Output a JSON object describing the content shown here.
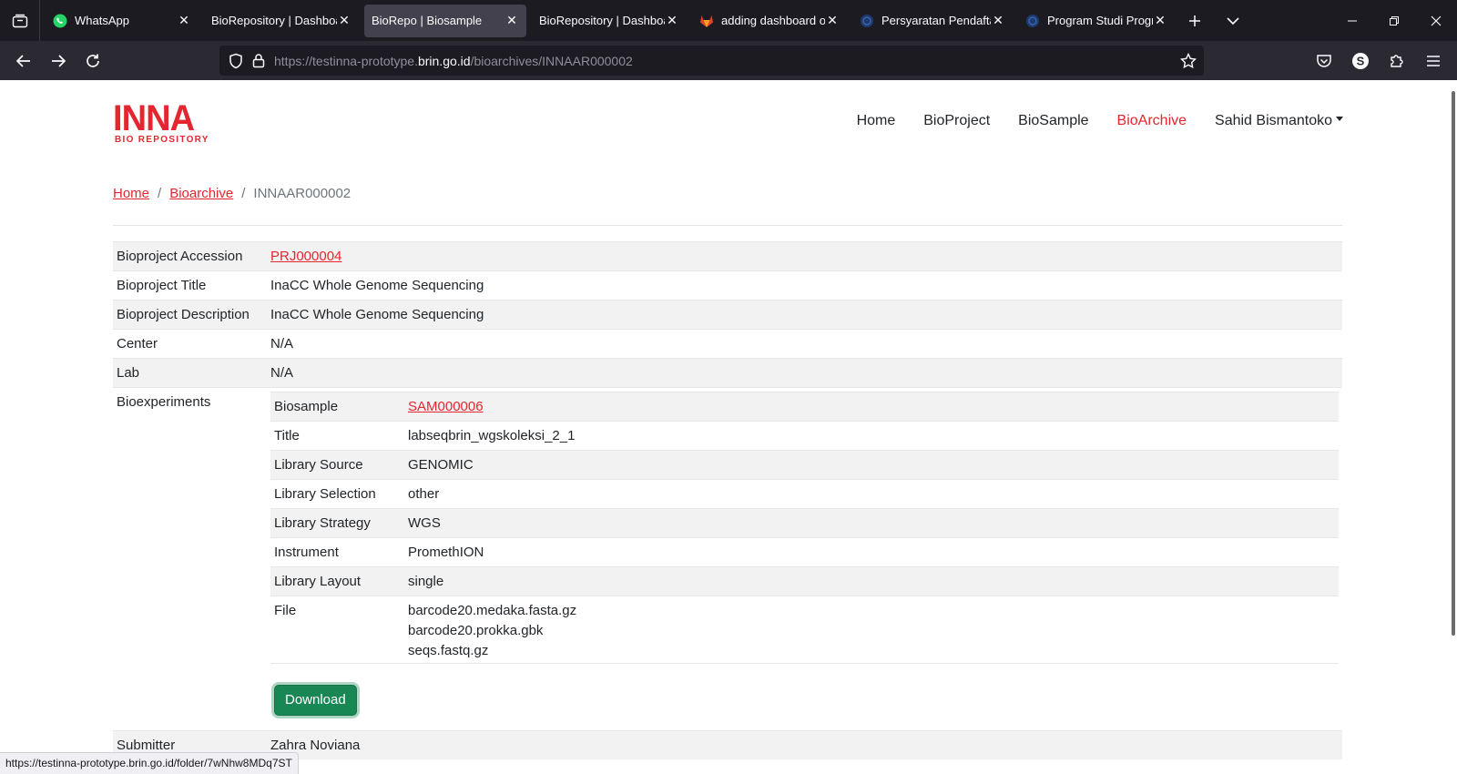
{
  "browser": {
    "tabs": [
      {
        "title": "WhatsApp",
        "active": false,
        "icon": "whatsapp-icon"
      },
      {
        "title": "BioRepository | Dashboard",
        "active": false,
        "icon": ""
      },
      {
        "title": "BioRepo | Biosample",
        "active": true,
        "icon": ""
      },
      {
        "title": "BioRepository | Dashboard",
        "active": false,
        "icon": ""
      },
      {
        "title": "adding dashboard on l",
        "active": false,
        "icon": "gitlab-icon"
      },
      {
        "title": "Persyaratan Pendaftara",
        "active": false,
        "icon": "globe-icon"
      },
      {
        "title": "Program Studi Progran",
        "active": false,
        "icon": "globe-icon"
      }
    ],
    "url_prefix": "https://testinna-prototype.",
    "url_domain": "brin.go.id",
    "url_path": "/bioarchives/INNAAR000002",
    "status_url": "https://testinna-prototype.brin.go.id/folder/7wNhw8MDq7ST"
  },
  "site": {
    "logo_main": "INNA",
    "logo_sub": "BIO REPOSITORY",
    "nav": [
      {
        "label": "Home",
        "active": false
      },
      {
        "label": "BioProject",
        "active": false
      },
      {
        "label": "BioSample",
        "active": false
      },
      {
        "label": "BioArchive",
        "active": true
      }
    ],
    "user_menu": "Sahid Bismantoko",
    "accent": "#e3262f"
  },
  "breadcrumb": {
    "home": "Home",
    "section": "Bioarchive",
    "current": "INNAAR000002"
  },
  "details": {
    "accession_label": "Bioproject Accession",
    "accession_value": "PRJ000004",
    "title_label": "Bioproject Title",
    "title_value": "InaCC Whole Genome Sequencing",
    "description_label": "Bioproject Description",
    "description_value": "InaCC Whole Genome Sequencing",
    "center_label": "Center",
    "center_value": "N/A",
    "lab_label": "Lab",
    "lab_value": "N/A",
    "bioexperiments_label": "Bioexperiments",
    "submitter_label": "Submitter",
    "submitter_value": "Zahra Noviana"
  },
  "experiment": {
    "biosample_label": "Biosample",
    "biosample_value": "SAM000006",
    "title_label": "Title",
    "title_value": "labseqbrin_wgskoleksi_2_1",
    "library_source_label": "Library Source",
    "library_source_value": "GENOMIC",
    "library_selection_label": "Library Selection",
    "library_selection_value": "other",
    "library_strategy_label": "Library Strategy",
    "library_strategy_value": "WGS",
    "instrument_label": "Instrument",
    "instrument_value": "PromethION",
    "library_layout_label": "Library Layout",
    "library_layout_value": "single",
    "file_label": "File",
    "files": [
      "barcode20.medaka.fasta.gz",
      "barcode20.prokka.gbk",
      "seqs.fastq.gz"
    ],
    "download_label": "Download",
    "download_color": "#198754"
  }
}
